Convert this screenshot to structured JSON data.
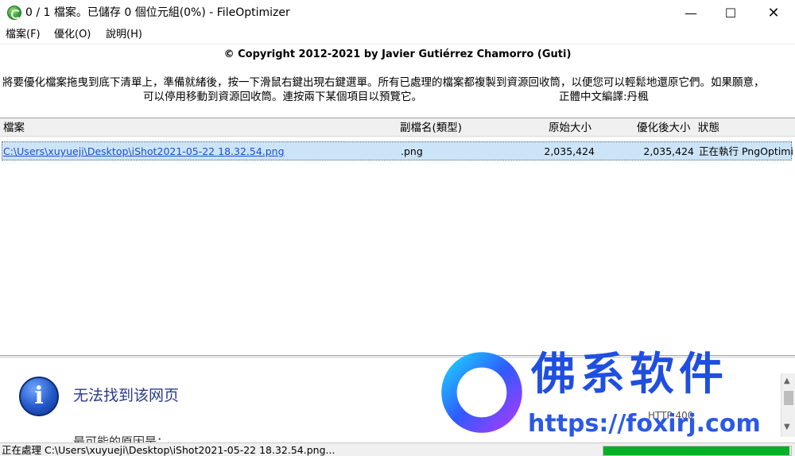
{
  "window": {
    "title": "0 / 1 檔案。已儲存 0 個位元組(0%) - FileOptimizer",
    "minimize_glyph": "—",
    "maximize_glyph": "☐",
    "close_glyph": "✕"
  },
  "menu": {
    "items": [
      {
        "label": "檔案(F)"
      },
      {
        "label": "優化(O)"
      },
      {
        "label": "說明(H)"
      }
    ]
  },
  "copyright": "© Copyright 2012-2021 by Javier Gutiérrez Chamorro (Guti)",
  "instructions": {
    "line1": "將要優化檔案拖曳到底下清單上，準備就緒後，按一下滑鼠右鍵出現右鍵選單。所有已處理的檔案都複製到資源回收筒，以便您可以輕鬆地還原它們。如果願意，",
    "line2": "可以停用移動到資源回收筒。連按兩下某個項目以預覽它。",
    "credit": "正體中文編譯:丹楓"
  },
  "list": {
    "columns": [
      "檔案",
      "副檔名(類型)",
      "原始大小",
      "優化後大小",
      "狀態"
    ],
    "rows": [
      {
        "path": "C:\\Users\\xuyueji\\Desktop\\iShot2021-05-22 18.32.54.png",
        "ext": ".png",
        "original_size": "2,035,424",
        "optimized_size": "2,035,424",
        "status": "正在執行 PngOptimizer"
      }
    ]
  },
  "bottom_panel": {
    "icon": "info-icon",
    "error_title": "无法找到该网页",
    "http_code": "HTTP 400",
    "partial_line": "最可能的原因是："
  },
  "watermark": {
    "cn_text": "佛系软件",
    "url": "https://foxirj.com"
  },
  "statusbar": {
    "text": "正在處理 C:\\Users\\xuyueji\\Desktop\\iShot2021-05-22 18.32.54.png...",
    "progress_fraction": 0.99
  },
  "colors": {
    "accent": "#06b025",
    "selection": "#cce4f7",
    "link": "#1a4fd1",
    "watermark_blue": "#1f4fe0"
  }
}
